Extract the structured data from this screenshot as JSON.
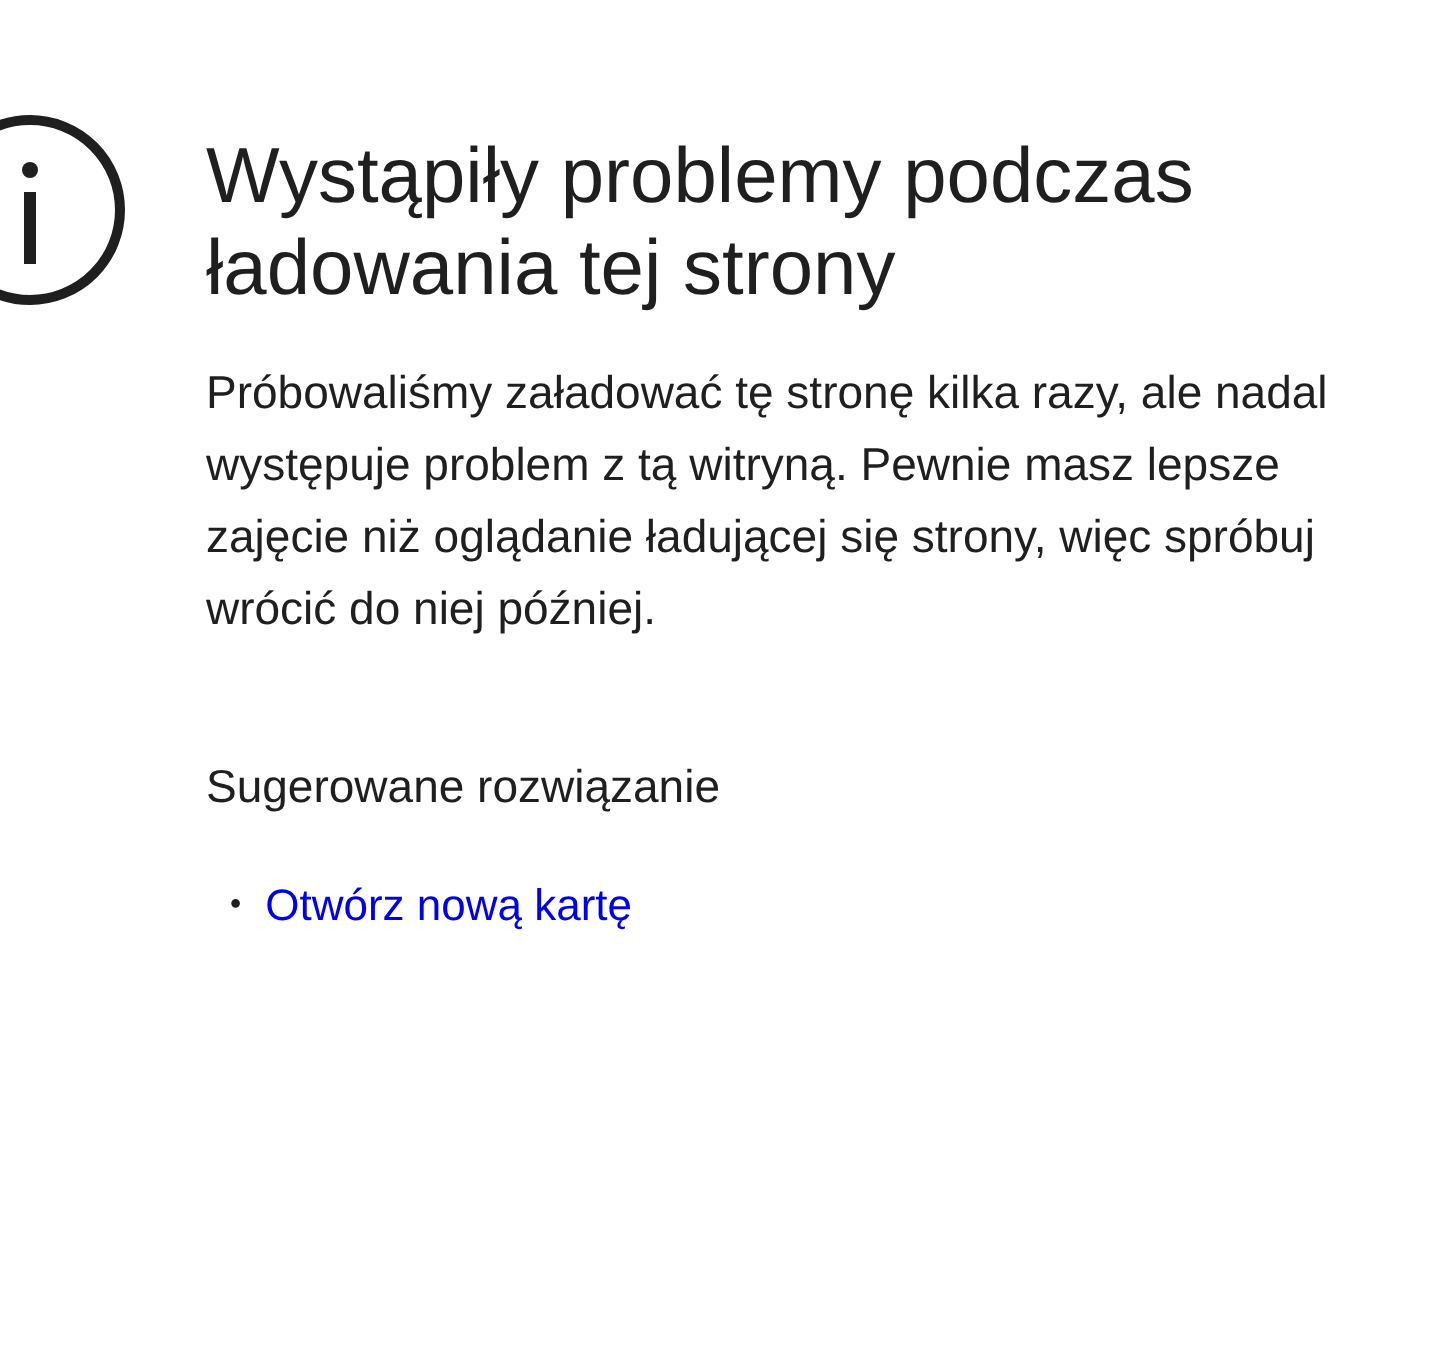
{
  "title": "Wystąpiły problemy podczas ładowania tej strony",
  "message": "Próbowaliśmy załadować tę stronę kilka razy, ale nadal występuje problem z tą witryną. Pewnie masz lepsze zajęcie niż oglądanie ładującej się strony, więc spróbuj wrócić do niej później.",
  "suggestions_heading": "Sugerowane rozwiązanie",
  "suggestions": [
    {
      "bullet": "•",
      "link": "Otwórz nową kartę"
    }
  ]
}
